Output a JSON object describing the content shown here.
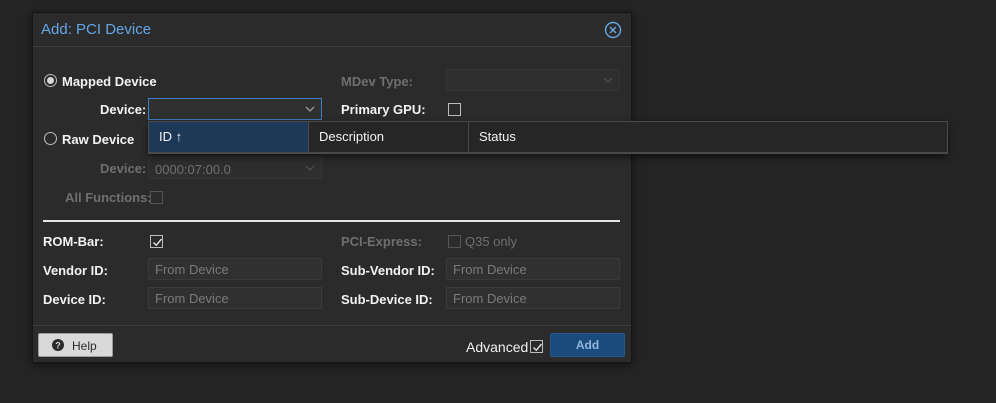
{
  "dialog": {
    "title": "Add: PCI Device",
    "close_icon": "close-circle-icon"
  },
  "mapped": {
    "radio_label": "Mapped Device",
    "selected": true,
    "device_label": "Device:",
    "device_value": ""
  },
  "raw": {
    "radio_label": "Raw Device",
    "selected": false,
    "device_label": "Device:",
    "device_value": "0000:07:00.0",
    "all_functions_label": "All Functions:",
    "all_functions_checked": false
  },
  "mdev": {
    "label": "MDev Type:",
    "value": ""
  },
  "primary_gpu": {
    "label": "Primary GPU:",
    "checked": false
  },
  "rom_bar": {
    "label": "ROM-Bar:",
    "checked": true
  },
  "pci_express": {
    "label": "PCI-Express:",
    "option_label": "Q35 only",
    "checked": false
  },
  "vendor_id": {
    "label": "Vendor ID:",
    "placeholder": "From Device"
  },
  "device_id": {
    "label": "Device ID:",
    "placeholder": "From Device"
  },
  "sub_vendor_id": {
    "label": "Sub-Vendor ID:",
    "placeholder": "From Device"
  },
  "sub_device_id": {
    "label": "Sub-Device ID:",
    "placeholder": "From Device"
  },
  "footer": {
    "help_label": "Help",
    "help_icon": "question-circle-icon",
    "advanced_label": "Advanced",
    "advanced_checked": true,
    "add_label": "Add"
  },
  "device_grid": {
    "columns": [
      {
        "label": "ID ↑",
        "sorted": "asc"
      },
      {
        "label": "Description"
      },
      {
        "label": "Status"
      }
    ]
  },
  "colors": {
    "accent": "#64a6e6",
    "primary_button": "#1b4a7d",
    "background": "#252525",
    "dialog": "#2b2b2b"
  }
}
